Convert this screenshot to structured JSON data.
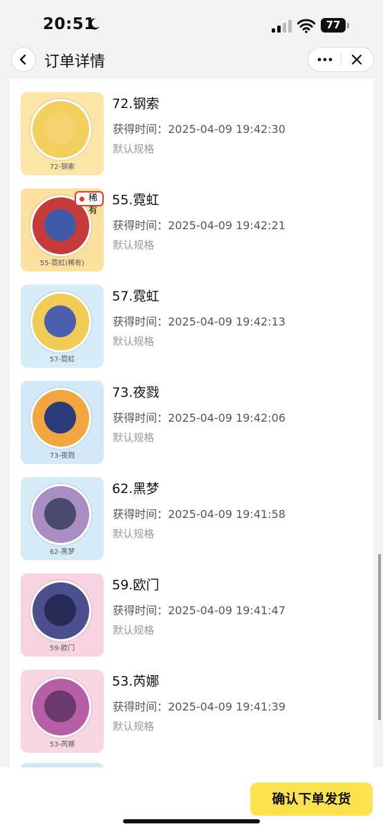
{
  "status_bar": {
    "time": "20:51",
    "battery": "77"
  },
  "nav": {
    "title": "订单详情"
  },
  "items": [
    {
      "name": "72.钢索",
      "time": "获得时间：2025-04-09 19:42:30",
      "spec": "默认规格",
      "caption": "72-钢索",
      "bg": "#fbe6a8",
      "ring": "#f3cf5e",
      "face": "#f6d36f"
    },
    {
      "name": "55.霓虹",
      "time": "获得时间：2025-04-09 19:42:21",
      "spec": "默认规格",
      "caption": "55-霓虹(稀有)",
      "bg": "#fbe0a0",
      "ring": "#c63a3a",
      "face": "#3e5aa8",
      "rare": "稀有"
    },
    {
      "name": "57.霓虹",
      "time": "获得时间：2025-04-09 19:42:13",
      "spec": "默认规格",
      "caption": "57-霓虹",
      "bg": "#d6ecf8",
      "ring": "#f0cc54",
      "face": "#4b5fae"
    },
    {
      "name": "73.夜戮",
      "time": "获得时间：2025-04-09 19:42:06",
      "spec": "默认规格",
      "caption": "73-夜戮",
      "bg": "#d3e9f7",
      "ring": "#f2a640",
      "face": "#2b3c7a"
    },
    {
      "name": "62.黑梦",
      "time": "获得时间：2025-04-09 19:41:58",
      "spec": "默认规格",
      "caption": "62-黑梦",
      "bg": "#d6ebf8",
      "ring": "#a98ec4",
      "face": "#4a4a6e"
    },
    {
      "name": "59.欧门",
      "time": "获得时间：2025-04-09 19:41:47",
      "spec": "默认规格",
      "caption": "59-欧门",
      "bg": "#f8d3e2",
      "ring": "#4c4f8e",
      "face": "#262c55"
    },
    {
      "name": "53.芮娜",
      "time": "获得时间：2025-04-09 19:41:39",
      "spec": "默认规格",
      "caption": "53-芮娜",
      "bg": "#f8d6e4",
      "ring": "#b65ea6",
      "face": "#6a3a6e"
    }
  ],
  "footer": {
    "confirm_label": "确认下单发货"
  }
}
